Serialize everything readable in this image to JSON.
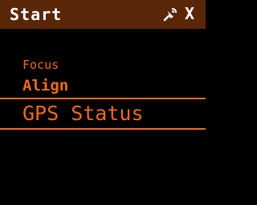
{
  "header": {
    "title": "Start",
    "close_label": "X",
    "signal_icon": "satellite-signal-icon"
  },
  "menu": {
    "items": [
      {
        "label": "Focus"
      },
      {
        "label": "Align"
      },
      {
        "label": "GPS Status",
        "selected": true
      }
    ]
  },
  "colors": {
    "header_bg": "#5a2608",
    "accent": "#f06a1c",
    "background": "#000000",
    "header_text": "#ffffff"
  }
}
